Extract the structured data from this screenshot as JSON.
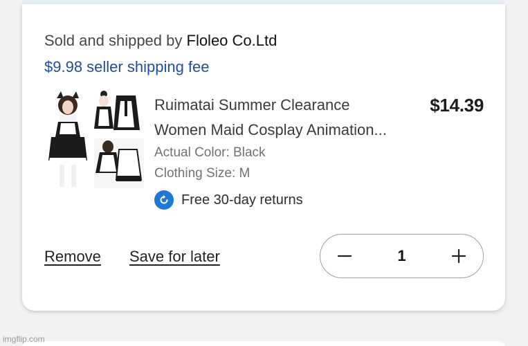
{
  "seller": {
    "prefix": "Sold and shipped by",
    "name": "Floleo Co.Ltd",
    "shipping_fee": "$9.98 seller shipping fee"
  },
  "product": {
    "title_line1": "Ruimatai Summer Clearance",
    "title_line2": "Women Maid Cosplay Animation...",
    "price": "$14.39",
    "color": "Actual Color: Black",
    "size": "Clothing Size: M",
    "returns": "Free 30-day returns"
  },
  "actions": {
    "remove": "Remove",
    "save_for_later": "Save for later"
  },
  "quantity": {
    "value": "1"
  },
  "watermark": "imgflip.com",
  "colors": {
    "shipping_fee": "#1f4fa3",
    "returns_icon": "#1e78d6"
  },
  "icons": {
    "returns": "refresh-icon",
    "decrement": "minus-icon",
    "increment": "plus-icon"
  }
}
